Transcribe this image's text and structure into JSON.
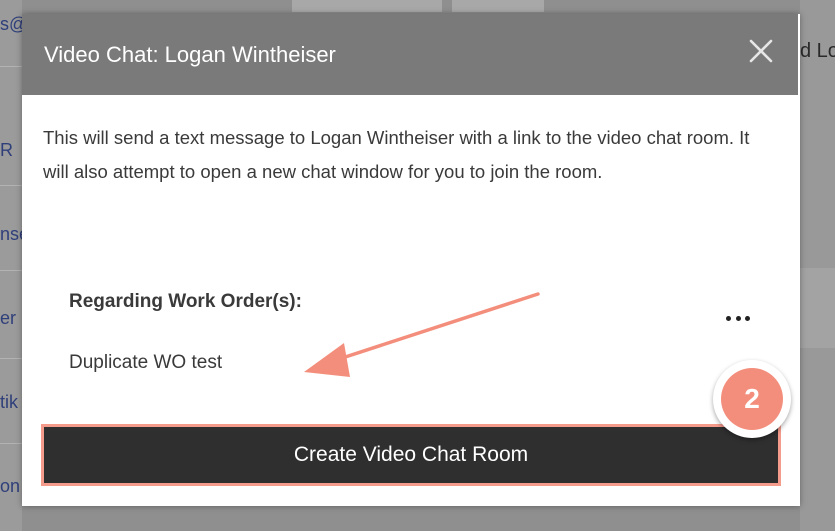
{
  "background": {
    "left_fragments": [
      "s@",
      "R",
      "nse",
      "er",
      "tik",
      "on"
    ],
    "right_fragment": "d Lo"
  },
  "modal": {
    "title": "Video Chat: Logan Wintheiser",
    "close_icon": "close-icon",
    "description": "This will send a text message to Logan Wintheiser with a link to the video chat room. It will also attempt to open a new chat window for you to join the room.",
    "work_orders_label": "Regarding Work Order(s):",
    "work_orders": [
      "Duplicate WO test"
    ],
    "more_icon": "more-horizontal-icon",
    "create_button_label": "Create Video Chat Room"
  },
  "annotation": {
    "step_number": "2",
    "arrow_color": "#f48e7c",
    "badge_color": "#f48e7c"
  },
  "colors": {
    "header": "#7a7a7a",
    "button": "#2f2f2f",
    "button_outline": "#f59b8b"
  }
}
